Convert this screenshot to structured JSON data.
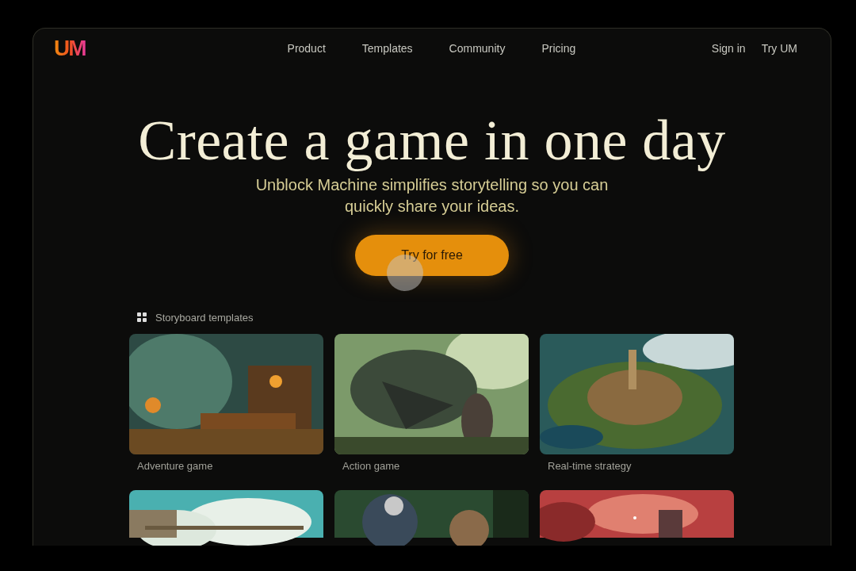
{
  "logo": "UM",
  "nav": [
    {
      "label": "Product"
    },
    {
      "label": "Templates"
    },
    {
      "label": "Community"
    },
    {
      "label": "Pricing"
    }
  ],
  "account": [
    {
      "label": "Sign in"
    },
    {
      "label": "Try UM"
    }
  ],
  "hero": {
    "title": "Create a game in one day",
    "subtitle": "Unblock Machine simplifies storytelling so you can quickly share your ideas.",
    "cta": "Try for free"
  },
  "section": {
    "title": "Storyboard templates"
  },
  "cards": [
    {
      "kind": "picture",
      "title": "Adventure game"
    },
    {
      "kind": "picture",
      "title": "Action game"
    },
    {
      "kind": "picture",
      "title": "Real-time strategy"
    },
    {
      "kind": "picture"
    },
    {
      "kind": "picture"
    },
    {
      "kind": "picture"
    }
  ]
}
